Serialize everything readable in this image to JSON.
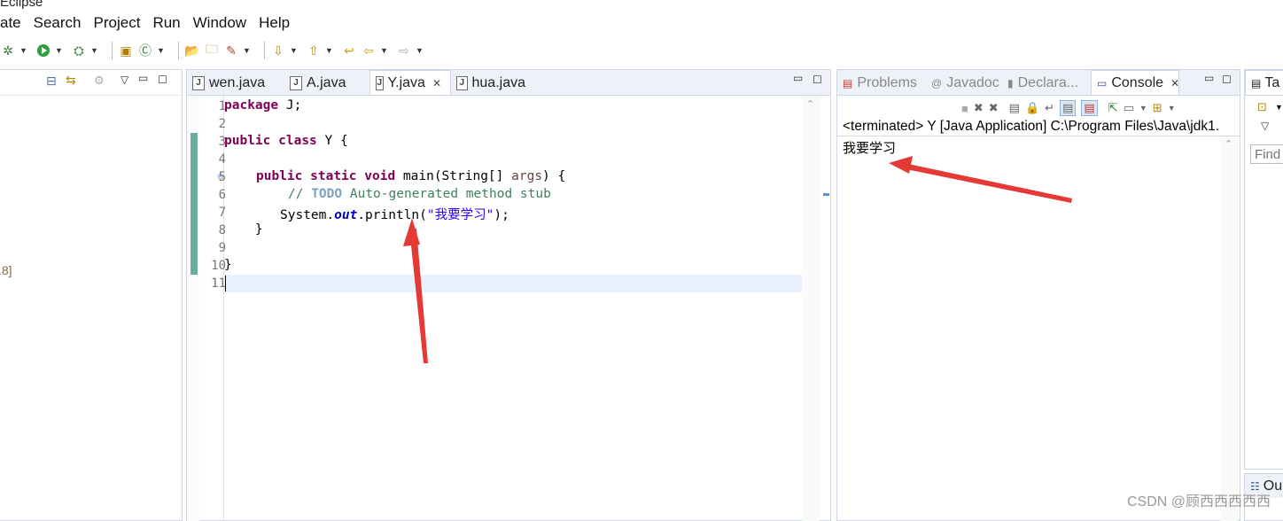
{
  "window": {
    "title_fragment": "Eclipse"
  },
  "menu": [
    "ate",
    "Search",
    "Project",
    "Run",
    "Window",
    "Help"
  ],
  "left_panel": {
    "fragment_text": ".8]"
  },
  "editor": {
    "tabs": [
      {
        "label": "wen.java",
        "active": false
      },
      {
        "label": "A.java",
        "active": false
      },
      {
        "label": "Y.java",
        "active": true
      },
      {
        "label": "hua.java",
        "active": false
      }
    ],
    "lines": [
      "1",
      "2",
      "3",
      "4",
      "5",
      "6",
      "7",
      "8",
      "9",
      "10",
      "11"
    ],
    "code": {
      "l1_kw": "package",
      "l1_rest": " J;",
      "l3_kw1": "public",
      "l3_kw2": "class",
      "l3_rest": " Y {",
      "l5_kw1": "public",
      "l5_kw2": "static",
      "l5_kw3": "void",
      "l5_mid": " main(String[] ",
      "l5_var": "args",
      "l5_end": ") {",
      "l6_cm1": "// ",
      "l6_todo": "TODO",
      "l6_cm2": " Auto-generated method stub",
      "l7_a": "System.",
      "l7_fld": "out",
      "l7_b": ".println(",
      "l7_str": "\"我要学习\"",
      "l7_c": ");",
      "l8": "    }",
      "l10": "}"
    }
  },
  "console_panel": {
    "tabs": [
      {
        "label": "Problems",
        "active": false
      },
      {
        "label": "Javadoc",
        "active": false
      },
      {
        "label": "Declara...",
        "active": false
      },
      {
        "label": "Console",
        "active": true
      }
    ],
    "status": "<terminated> Y [Java Application] C:\\Program Files\\Java\\jdk1.",
    "output": "我要学习"
  },
  "right_panel": {
    "tab_label": "Ta",
    "find_placeholder": "Find",
    "bottom_tab": "Ou"
  },
  "watermark": "CSDN @顾西西西西西",
  "colors": {
    "annotation_arrow": "#e53935",
    "keyword": "#7f0055",
    "string": "#2a00ff"
  }
}
